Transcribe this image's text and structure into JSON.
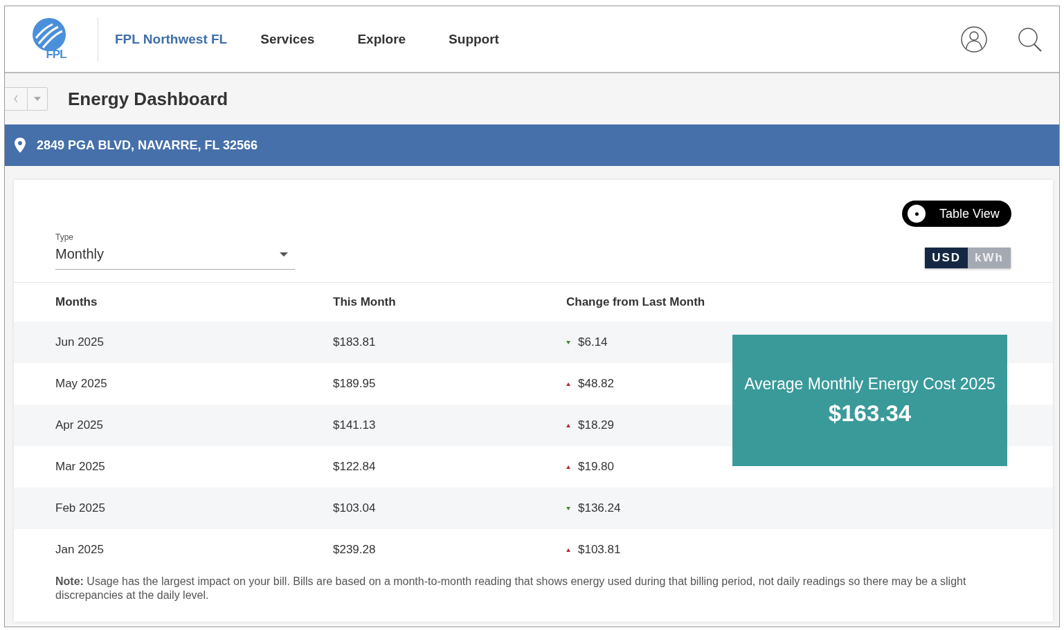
{
  "header": {
    "logo_text": "FPL",
    "brand": "FPL Northwest FL",
    "nav": [
      {
        "label": "Services"
      },
      {
        "label": "Explore"
      },
      {
        "label": "Support"
      }
    ]
  },
  "page_title": "Energy Dashboard",
  "address": "2849 PGA BLVD, NAVARRE, FL 32566",
  "view_toggle": {
    "label": "Table View",
    "on": true
  },
  "type_select": {
    "label": "Type",
    "value": "Monthly"
  },
  "units": [
    {
      "label": "USD",
      "selected": true
    },
    {
      "label": "kWh",
      "selected": false
    }
  ],
  "table": {
    "columns": [
      "Months",
      "This Month",
      "Change from Last Month"
    ],
    "rows": [
      {
        "month": "Jun 2025",
        "this_month": "$183.81",
        "increased": false,
        "change": "$6.14"
      },
      {
        "month": "May 2025",
        "this_month": "$189.95",
        "increased": true,
        "change": "$48.82"
      },
      {
        "month": "Apr 2025",
        "this_month": "$141.13",
        "increased": true,
        "change": "$18.29"
      },
      {
        "month": "Mar 2025",
        "this_month": "$122.84",
        "increased": true,
        "change": "$19.80"
      },
      {
        "month": "Feb 2025",
        "this_month": "$103.04",
        "increased": false,
        "change": "$136.24"
      },
      {
        "month": "Jan 2025",
        "this_month": "$239.28",
        "increased": true,
        "change": "$103.81"
      }
    ]
  },
  "average_card": {
    "title": "Average Monthly Energy Cost 2025",
    "value": "$163.34"
  },
  "note": "**Note:** Usage has the largest impact on your bill. Bills are based on a month-to-month reading that shows energy used during that billing period, not daily readings so there may be a slight discrepancies at the daily level."
}
